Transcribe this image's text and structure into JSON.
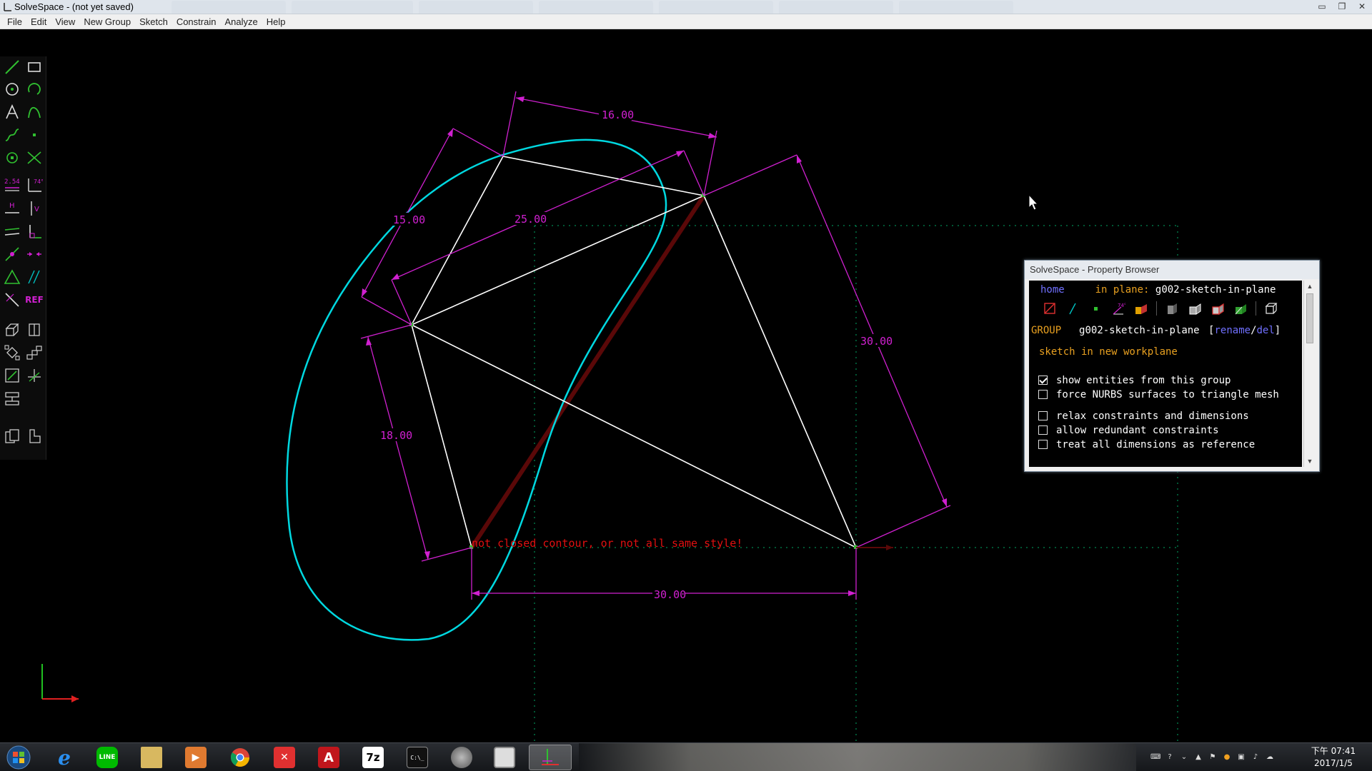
{
  "window": {
    "title": "SolveSpace - (not yet saved)",
    "controls": {
      "minimize": "▭",
      "maximize": "❐",
      "close": "✕"
    },
    "background_tabs": [
      "",
      "",
      "",
      "",
      "",
      "",
      "",
      ""
    ]
  },
  "menu": {
    "items": [
      "File",
      "Edit",
      "View",
      "New Group",
      "Sketch",
      "Constrain",
      "Analyze",
      "Help"
    ]
  },
  "toolbar": {
    "tools": [
      "line-icon",
      "rectangle-icon",
      "circle-icon",
      "arc-icon",
      "text-icon",
      "tangent-arc-icon",
      "cubic-spline-icon",
      "datum-point-icon",
      "workplane-icon",
      "split-curves-icon",
      "distance-dimension-icon",
      "angle-dimension-icon",
      "horizontal-constraint-icon",
      "vertical-constraint-icon",
      "parallel-constraint-icon",
      "perpendicular-constraint-icon",
      "point-on-line-icon",
      "symmetric-constraint-icon",
      "equal-constraint-icon",
      "same-orientation-icon",
      "other-supplementary-icon",
      "reference-toggle-icon",
      "extrude-icon",
      "lathe-icon",
      "step-rotate-icon",
      "step-translate-icon",
      "sketch-in-workplane-icon",
      "sketch-in-3d-icon",
      "link-file-icon",
      "construction-toggle-icon",
      "nearest-iso-icon"
    ],
    "angle_label": "74°",
    "distance_label": "2.54",
    "horizontal_label": "H",
    "vertical_label": "V",
    "ref_label": "REF"
  },
  "sketch": {
    "dimensions": [
      "16.00",
      "15.00",
      "25.00",
      "30.00",
      "18.00",
      "30.00"
    ],
    "error_message": "not closed contour, or not all same style!",
    "colors": {
      "spline": "#00d8e0",
      "lines": "#ffffff",
      "dimensions": "#d020d0",
      "construction": "#6a0a0a",
      "grid": "#00aa66",
      "error": "#e01010"
    }
  },
  "property_browser": {
    "title": "SolveSpace - Property Browser",
    "home_link": "home",
    "in_plane_label": "in plane:",
    "in_plane_value": "g002-sketch-in-plane",
    "group_label": "GROUP",
    "group_name": "g002-sketch-in-plane",
    "bracket_open": "[",
    "rename_link": "rename",
    "slash": "/",
    "del_link": "del",
    "bracket_close": "]",
    "group_type": "sketch in new workplane",
    "options": [
      {
        "label": "show entities from this group",
        "checked": true
      },
      {
        "label": "force NURBS surfaces to triangle mesh",
        "checked": false
      },
      {
        "label": "relax constraints and dimensions",
        "checked": false
      },
      {
        "label": "allow redundant constraints",
        "checked": false
      },
      {
        "label": "treat all dimensions as reference",
        "checked": false
      }
    ],
    "icon_74_label": "74°"
  },
  "taskbar": {
    "apps": [
      {
        "name": "internet-explorer",
        "label": "e",
        "color": "#1e90ff"
      },
      {
        "name": "line",
        "label": "LINE",
        "color": "#00b900"
      },
      {
        "name": "file-explorer",
        "label": "",
        "color": "#d8b860"
      },
      {
        "name": "media-player",
        "label": "▶",
        "color": "#e07a30"
      },
      {
        "name": "chrome",
        "label": "",
        "color": "#ffffff"
      },
      {
        "name": "xmind",
        "label": "✕",
        "color": "#e03030"
      },
      {
        "name": "adobe-reader",
        "label": "A",
        "color": "#c0161c"
      },
      {
        "name": "7zip",
        "label": "7z",
        "color": "#ffffff"
      },
      {
        "name": "command-prompt",
        "label": "C:\\_",
        "color": "#111111"
      },
      {
        "name": "globe-app",
        "label": "",
        "color": "#888888"
      },
      {
        "name": "monitor-app",
        "label": "",
        "color": "#dddddd"
      },
      {
        "name": "solvespace",
        "label": "",
        "color": "#30c030"
      }
    ],
    "clock_time": "下午 07:41",
    "clock_date": "2017/1/5"
  }
}
